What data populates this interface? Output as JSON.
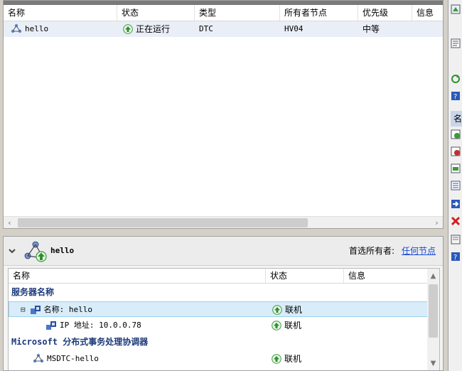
{
  "colors": {
    "accent_link": "#1a4ad6",
    "selection": "#d8ecf9",
    "group_text": "#1d3a7a",
    "status_ok": "#3a9a3a"
  },
  "top_list": {
    "columns": [
      "名称",
      "状态",
      "类型",
      "所有者节点",
      "优先级",
      "信息"
    ],
    "rows": [
      {
        "name": "hello",
        "status": "正在运行",
        "type": "DTC",
        "owner_node": "HV04",
        "priority": "中等",
        "info": ""
      }
    ],
    "scroll_left_arrow": "‹",
    "scroll_right_arrow": "›"
  },
  "detail": {
    "title": "hello",
    "preferred_owner_label": "首选所有者:",
    "preferred_owner_link": "任何节点",
    "columns": [
      "名称",
      "状态",
      "信息"
    ],
    "groups": [
      {
        "label": "服务器名称"
      },
      {
        "label": "Microsoft 分布式事务处理协调器"
      }
    ],
    "rows": [
      {
        "name": "名称: hello",
        "status": "联机"
      },
      {
        "name": "IP 地址: 10.0.0.78",
        "status": "联机"
      },
      {
        "name": "MSDTC-hello",
        "status": "联机"
      }
    ],
    "collapse_glyph": "⊟",
    "scroll_up_arrow": "▲",
    "scroll_down_arrow": "▼"
  },
  "actions": {
    "label": "名",
    "icons": [
      "resource-add-icon",
      "properties-icon",
      "refresh-icon",
      "help-icon",
      "bring-online-icon",
      "take-offline-icon",
      "add-storage-icon",
      "add-resource-icon",
      "move-icon",
      "delete-icon",
      "properties2-icon",
      "help2-icon"
    ]
  }
}
